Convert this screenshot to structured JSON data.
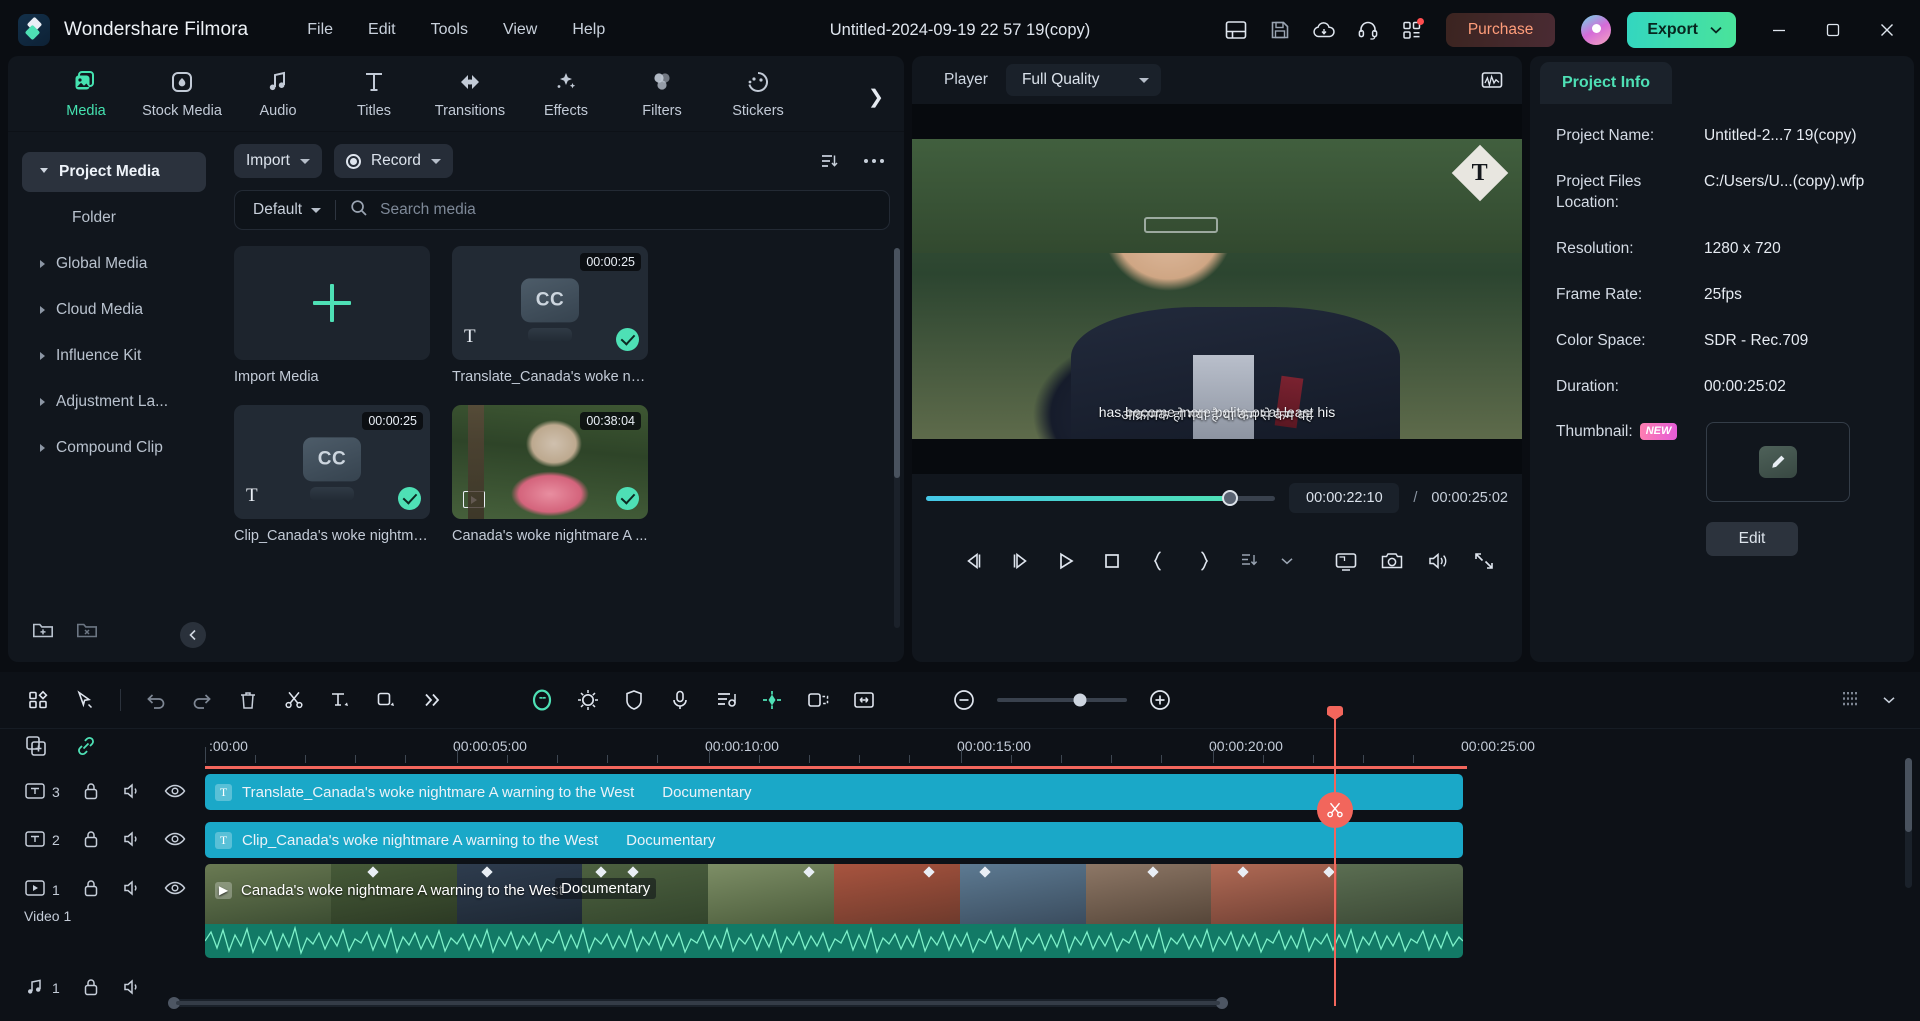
{
  "titlebar": {
    "brand": "Wondershare Filmora",
    "menus": [
      "File",
      "Edit",
      "Tools",
      "View",
      "Help"
    ],
    "project_title": "Untitled-2024-09-19 22 57 19(copy)",
    "icons": [
      "layout-icon",
      "save-icon",
      "cloud-upload-icon",
      "headset-icon",
      "apps-grid-icon"
    ],
    "purchase_label": "Purchase",
    "export_label": "Export",
    "window_controls": [
      "minimize",
      "maximize",
      "close"
    ]
  },
  "media_panel": {
    "tabs": [
      {
        "label": "Media",
        "icon": "media-icon",
        "active": true
      },
      {
        "label": "Stock Media",
        "icon": "stock-media-icon",
        "active": false
      },
      {
        "label": "Audio",
        "icon": "audio-note-icon",
        "active": false
      },
      {
        "label": "Titles",
        "icon": "titles-t-icon",
        "active": false
      },
      {
        "label": "Transitions",
        "icon": "transitions-icon",
        "active": false
      },
      {
        "label": "Effects",
        "icon": "effects-wand-icon",
        "active": false
      },
      {
        "label": "Filters",
        "icon": "filters-icon",
        "active": false
      },
      {
        "label": "Stickers",
        "icon": "stickers-icon",
        "active": false
      }
    ],
    "sidebar": [
      {
        "label": "Project Media",
        "selected": true,
        "expanded": true
      },
      {
        "label": "Folder",
        "selected": false,
        "sub": true
      },
      {
        "label": "Global Media",
        "selected": false
      },
      {
        "label": "Cloud Media",
        "selected": false
      },
      {
        "label": "Influence Kit",
        "selected": false
      },
      {
        "label": "Adjustment La...",
        "selected": false
      },
      {
        "label": "Compound Clip",
        "selected": false
      }
    ],
    "toolbar": {
      "import_label": "Import",
      "record_label": "Record",
      "filter_icon": "filter-icon",
      "more_icon": "more-horizontal-icon"
    },
    "search": {
      "sort_label": "Default",
      "placeholder": "Search media",
      "value": ""
    },
    "items": [
      {
        "caption": "Import Media",
        "kind": "import",
        "duration": "",
        "selected": false
      },
      {
        "caption": "Translate_Canada's woke nig...",
        "kind": "cc",
        "duration": "00:00:25",
        "selected": true
      },
      {
        "caption": "Clip_Canada's woke nightma...",
        "kind": "cc",
        "duration": "00:00:25",
        "selected": true
      },
      {
        "caption": "Canada's woke nightmare A ...",
        "kind": "video",
        "duration": "00:38:04",
        "selected": true
      }
    ]
  },
  "player": {
    "label": "Player",
    "quality": "Full Quality",
    "waveform_icon": "waveform-icon",
    "subtitle_line1": "has become more polite or at least his",
    "subtitle_line2": "आक्रामक हो गया है या कम से कम वह",
    "channel_logo": "T",
    "current_time": "00:00:22:10",
    "time_separator": "/",
    "total_time": "00:00:25:02",
    "progress_percent": 87,
    "controls": [
      {
        "icon": "prev-frame-icon",
        "name": "previous-frame-button"
      },
      {
        "icon": "next-frame-icon",
        "name": "next-frame-button"
      },
      {
        "icon": "play-icon",
        "name": "play-button"
      },
      {
        "icon": "stop-icon",
        "name": "stop-button"
      },
      {
        "icon": "mark-in-icon",
        "name": "mark-in-button"
      },
      {
        "icon": "mark-out-icon",
        "name": "mark-out-button"
      },
      {
        "icon": "snapshot-markers-icon",
        "name": "markers-button"
      },
      {
        "icon": "chevron-down-icon",
        "name": "markers-dropdown"
      },
      {
        "icon": "fullscreen-monitor-icon",
        "name": "display-button"
      },
      {
        "icon": "camera-icon",
        "name": "snapshot-button"
      },
      {
        "icon": "volume-icon",
        "name": "volume-button"
      },
      {
        "icon": "expand-icon",
        "name": "fullscreen-button"
      }
    ]
  },
  "project_info": {
    "tab_label": "Project Info",
    "rows": [
      {
        "label": "Project Name:",
        "value": "Untitled-2...7 19(copy)"
      },
      {
        "label": "Project Files Location:",
        "value": "C:/Users/U...(copy).wfp"
      },
      {
        "label": "Resolution:",
        "value": "1280 x 720"
      },
      {
        "label": "Frame Rate:",
        "value": "25fps"
      },
      {
        "label": "Color Space:",
        "value": "SDR - Rec.709"
      },
      {
        "label": "Duration:",
        "value": "00:00:25:02"
      }
    ],
    "thumbnail_label": "Thumbnail:",
    "thumbnail_badge": "NEW",
    "edit_label": "Edit"
  },
  "timeline": {
    "toolbar_left": [
      "grid-view-icon",
      "select-tool-icon",
      "divider",
      "undo-icon",
      "redo-icon",
      "delete-icon",
      "split-scissors-icon",
      "add-text-icon",
      "crop-icon",
      "more-chevrons-icon"
    ],
    "toolbar_center": [
      "ai-smart-icon",
      "color-settings-icon",
      "mask-shield-icon",
      "mic-icon",
      "audio-mix-icon",
      "keyframe-icon",
      "auto-reframe-icon",
      "fit-icon"
    ],
    "zoom_out_icon": "zoom-out-icon",
    "zoom_in_icon": "zoom-in-icon",
    "zoom_percent": 64,
    "toolbar_right": [
      "marker-grid-icon",
      "chevron-down-icon"
    ],
    "head_icons": [
      "add-track-icon",
      "link-icon"
    ],
    "ruler_labels": [
      ":00:00",
      "00:00:05:00",
      "00:00:10:00",
      "00:00:15:00",
      "00:00:20:00",
      "00:00:25:00"
    ],
    "playhead_time": "00:00:22:10",
    "tracks": [
      {
        "number": "3",
        "icon": "text-track-icon",
        "type": "text",
        "clip_title": "Translate_Canada's woke nightmare A warning to the West",
        "clip_suffix": "Documentary",
        "controls": [
          "lock-icon",
          "mute-icon",
          "eye-icon"
        ]
      },
      {
        "number": "2",
        "icon": "text-track-icon",
        "type": "text",
        "clip_title": "Clip_Canada's woke nightmare A warning to the West",
        "clip_suffix": "Documentary",
        "controls": [
          "lock-icon",
          "mute-icon",
          "eye-icon"
        ]
      },
      {
        "number": "1",
        "icon": "video-track-icon",
        "type": "video",
        "name": "Video 1",
        "clip_title": "Canada's woke nightmare A warning to the West",
        "clip_suffix": "Documentary",
        "controls": [
          "lock-icon",
          "mute-icon",
          "eye-icon"
        ]
      },
      {
        "number": "1",
        "icon": "audio-track-icon",
        "type": "audio",
        "controls": [
          "lock-icon",
          "mute-icon"
        ]
      }
    ],
    "split_icon": "scissors-icon"
  },
  "colors": {
    "accent": "#4ee0b5",
    "playhead": "#f2665c",
    "text_clip": "#1aa8c8",
    "audio_clip": "#127a66",
    "purchase": "#ff9d7a"
  }
}
